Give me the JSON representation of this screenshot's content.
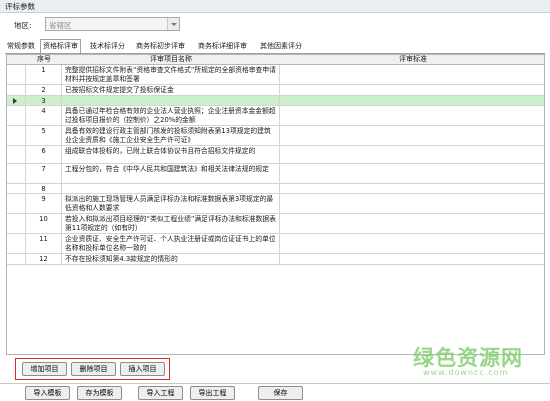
{
  "window": {
    "title": "评标参数"
  },
  "region": {
    "label": "地区:",
    "value": "省辖区"
  },
  "tabs": [
    {
      "label": "常规参数"
    },
    {
      "label": "资格标评审"
    },
    {
      "label": "技术标评分"
    },
    {
      "label": "商务标初步评审"
    },
    {
      "label": "商务标详细评审"
    },
    {
      "label": "其他因素评分"
    }
  ],
  "active_tab": 1,
  "columns": {
    "no": "序号",
    "name": "评审项目名称",
    "standard": "评审标准"
  },
  "rows": [
    {
      "no": "1",
      "name": "完整提供招标文件附表“资格审查文件格式”所规定的全部资格审查申请材料并按规定盖章和签署",
      "standard": ""
    },
    {
      "no": "2",
      "name": "已按招标文件规定提交了投标保证金",
      "standard": ""
    },
    {
      "no": "3",
      "name": "",
      "standard": ""
    },
    {
      "no": "4",
      "name": "具备已通过年检合格有效的企业法人营业执照；企业注册资本金金额超过投标项目报价的（控制价）之20%的金额",
      "standard": ""
    },
    {
      "no": "5",
      "name": "具备有效的建设行政主管部门核发的投标须知附表第13项规定的建筑业企业资质和《施工企业安全生产许可证》",
      "standard": ""
    },
    {
      "no": "6",
      "name": "组成联合体投标的，已附上联合体协议书且符合招标文件规定的",
      "standard": ""
    },
    {
      "no": "7",
      "name": "工程分包的，符合《中华人民共和国建筑法》和相关法律法规的规定",
      "standard": ""
    },
    {
      "no": "8",
      "name": "",
      "standard": ""
    },
    {
      "no": "9",
      "name": "拟派出的施工现场管理人员满足评标办法和标准数据表第3项规定的最低资格和人数要求",
      "standard": ""
    },
    {
      "no": "10",
      "name": "若投入和拟派出项目经理的“类似工程业绩”满足评标办法和标准数据表第11项规定的（如有时）",
      "standard": ""
    },
    {
      "no": "11",
      "name": "企业资质证、安全生产许可证、个人执业注册证或岗位证证书上的单位名称和投标单位名称一致的",
      "standard": ""
    },
    {
      "no": "12",
      "name": "不存在投标须知第4.3款规定的情形的",
      "standard": ""
    }
  ],
  "selected_row": 2,
  "row_buttons": {
    "add": "增加项目",
    "delete": "删除项目",
    "insert": "插入项目"
  },
  "footer_buttons": {
    "import_template": "导入模板",
    "save_template": "存为模板",
    "import_project": "导入工程",
    "export_project": "导出工程",
    "save": "保存"
  },
  "watermark": {
    "title": "绿色资源网",
    "url": "www.downcc.com"
  },
  "colors": {
    "selected_row": "#ccf0cc",
    "highlight_border": "#e02828",
    "watermark": "#8cd17c"
  }
}
